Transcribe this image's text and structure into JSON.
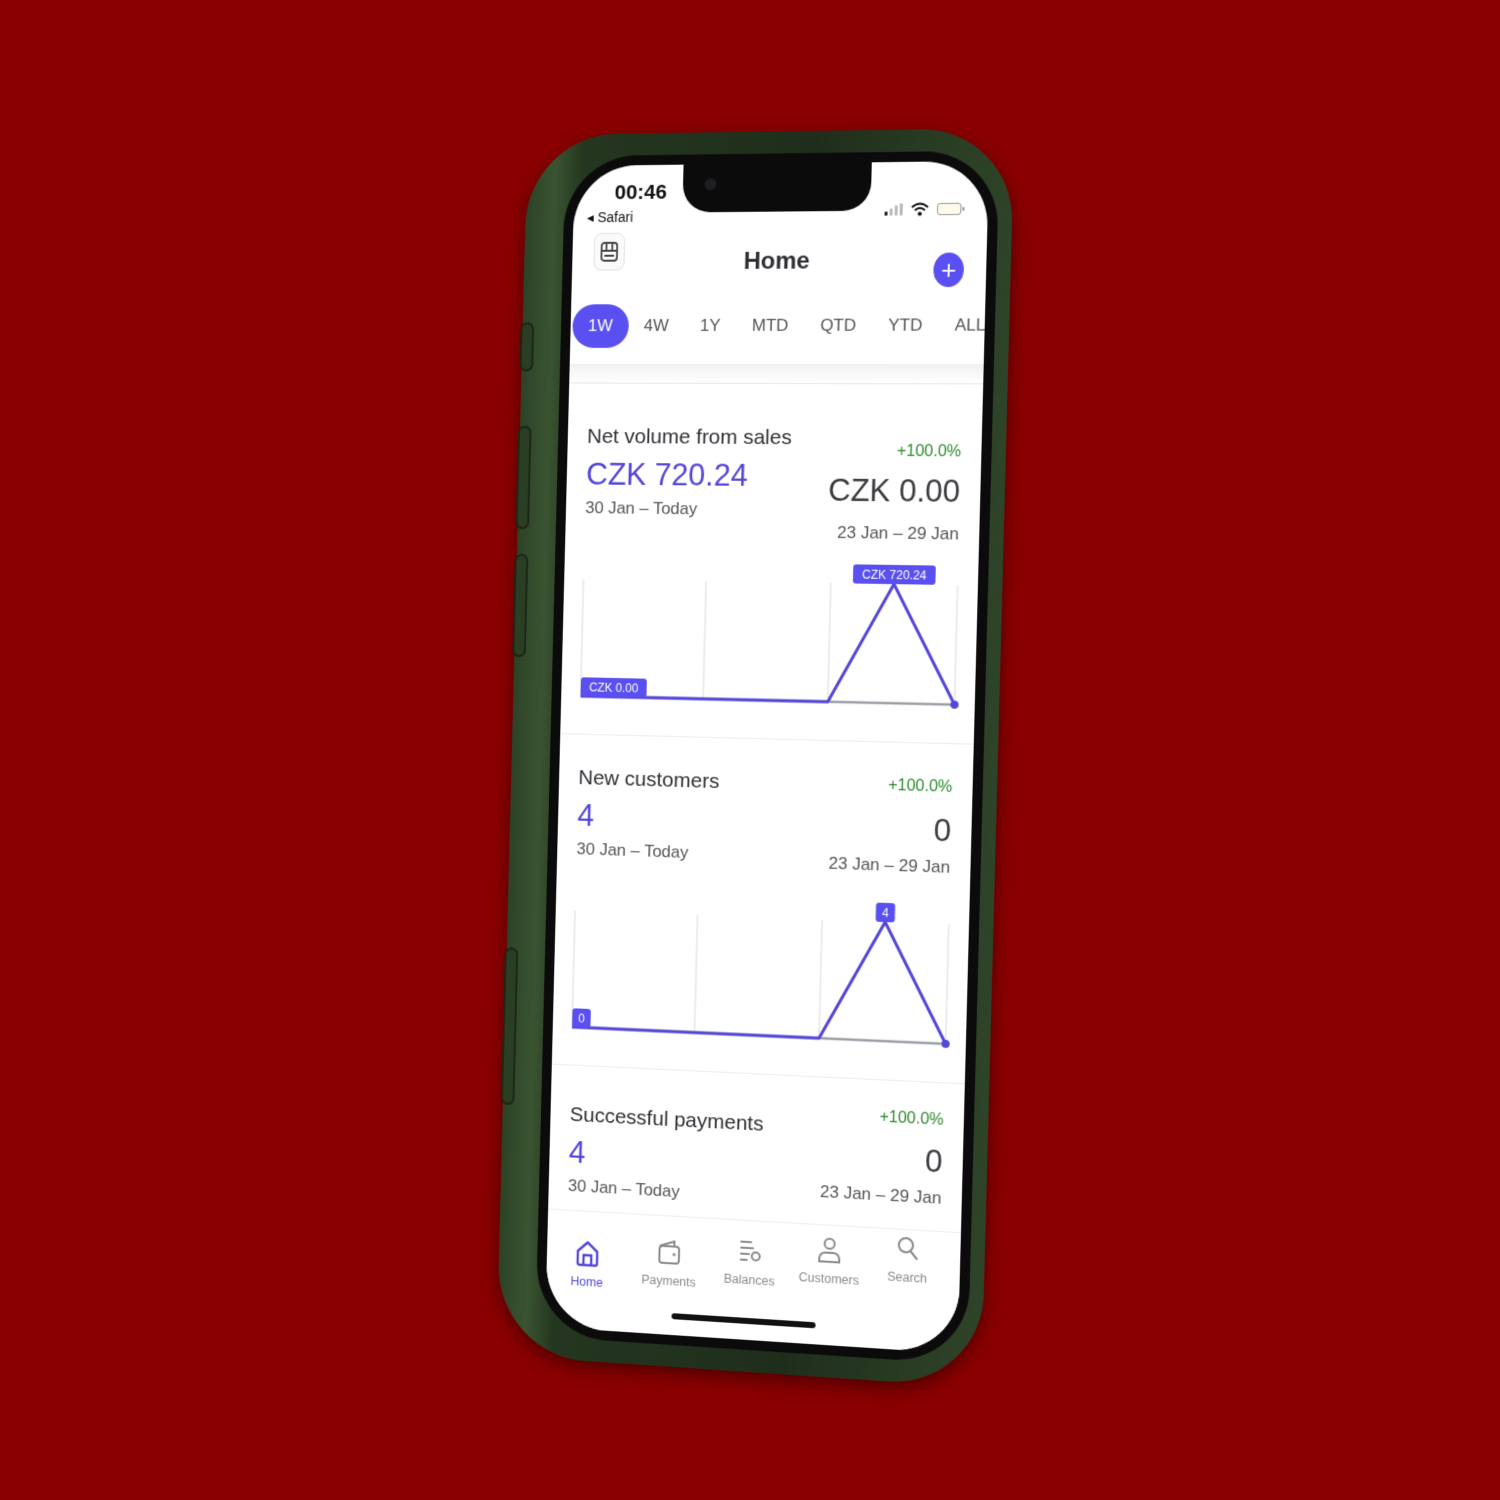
{
  "status_bar": {
    "time": "00:46",
    "back_app": "◂ Safari"
  },
  "header": {
    "title": "Home",
    "store_icon": "storefront-icon",
    "add_icon": "plus-icon",
    "add_glyph": "+"
  },
  "range_tabs": {
    "selected": "1W",
    "items": [
      {
        "label": "1W"
      },
      {
        "label": "4W"
      },
      {
        "label": "1Y"
      },
      {
        "label": "MTD"
      },
      {
        "label": "QTD"
      },
      {
        "label": "YTD"
      },
      {
        "label": "ALL"
      }
    ]
  },
  "colors": {
    "accent": "#5a4ff0",
    "value_purple": "#5446d8",
    "positive_green": "#2e8a2e",
    "background": "#8a0000",
    "prev_line": "#9aa0a6"
  },
  "cards": [
    {
      "title": "Net volume from sales",
      "change": "+100.0%",
      "current_value": "CZK 720.24",
      "current_range": "30 Jan – Today",
      "previous_value": "CZK 0.00",
      "previous_range": "23 Jan – 29 Jan"
    },
    {
      "title": "New customers",
      "change": "+100.0%",
      "current_value": "4",
      "current_range": "30 Jan – Today",
      "previous_value": "0",
      "previous_range": "23 Jan – 29 Jan"
    },
    {
      "title": "Successful payments",
      "change": "+100.0%",
      "current_value": "4",
      "current_range": "30 Jan – Today",
      "previous_value": "0",
      "previous_range": "23 Jan – 29 Jan"
    }
  ],
  "chart_data": [
    {
      "type": "line",
      "title": "Net volume from sales",
      "x": [
        0,
        1,
        2,
        3,
        4,
        5,
        6
      ],
      "series": [
        {
          "name": "30 Jan – Today",
          "values": [
            0,
            0,
            0,
            0,
            0,
            720.24,
            0
          ]
        },
        {
          "name": "23 Jan – 29 Jan",
          "values": [
            0,
            0,
            0,
            0,
            0,
            0,
            0
          ]
        }
      ],
      "min_label": "CZK 0.00",
      "max_label": "CZK 720.24",
      "ylim": [
        0,
        720.24
      ],
      "grid": true
    },
    {
      "type": "line",
      "title": "New customers",
      "x": [
        0,
        1,
        2,
        3,
        4,
        5,
        6
      ],
      "series": [
        {
          "name": "30 Jan – Today",
          "values": [
            0,
            0,
            0,
            0,
            0,
            4,
            0
          ]
        },
        {
          "name": "23 Jan – 29 Jan",
          "values": [
            0,
            0,
            0,
            0,
            0,
            0,
            0
          ]
        }
      ],
      "min_label": "0",
      "max_label": "4",
      "ylim": [
        0,
        4
      ],
      "grid": true
    }
  ],
  "bottom_nav": {
    "items": [
      {
        "label": "Home",
        "icon": "home-icon",
        "active": true
      },
      {
        "label": "Payments",
        "icon": "wallet-icon",
        "active": false
      },
      {
        "label": "Balances",
        "icon": "balances-icon",
        "active": false
      },
      {
        "label": "Customers",
        "icon": "person-icon",
        "active": false
      },
      {
        "label": "Search",
        "icon": "search-icon",
        "active": false
      }
    ]
  }
}
